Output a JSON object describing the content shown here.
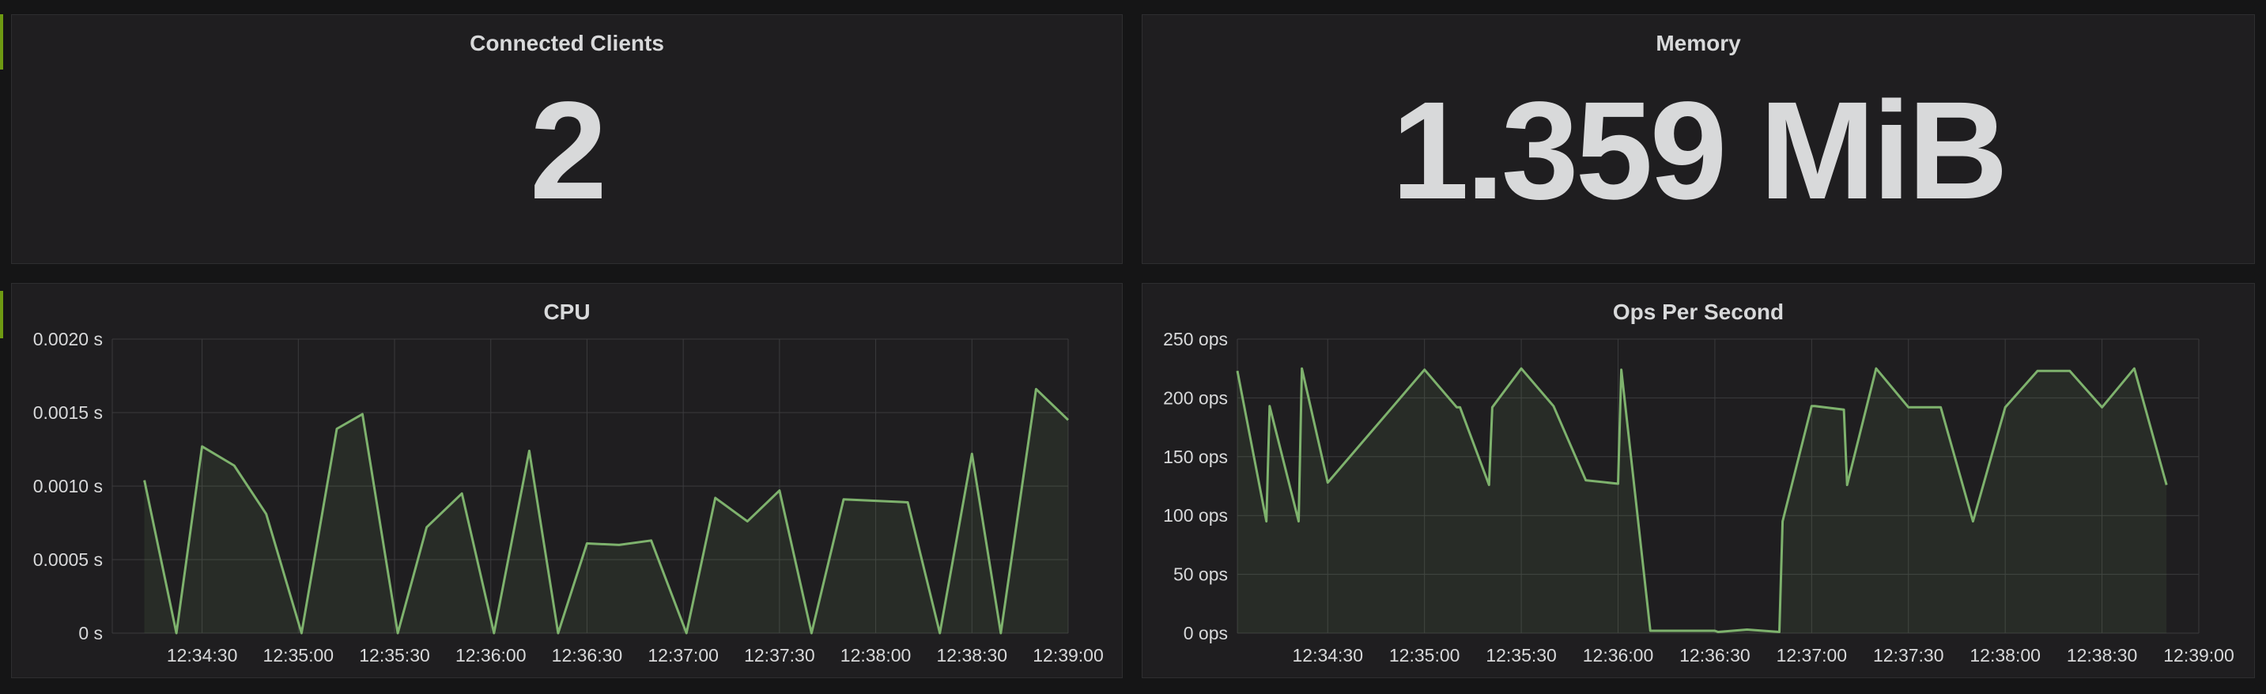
{
  "theme": {
    "background": "#151516",
    "panel": "#1f1e20",
    "row_marker": "#6e9a12",
    "series_color": "#7eb26d",
    "grid": "#3b3b3d"
  },
  "panels": {
    "clients": {
      "title": "Connected Clients",
      "value": "2"
    },
    "memory": {
      "title": "Memory",
      "value": "1.359 MiB"
    },
    "cpu": {
      "title": "CPU"
    },
    "ops": {
      "title": "Ops Per Second"
    }
  },
  "chart_data": [
    {
      "id": "cpu",
      "type": "area",
      "title": "CPU",
      "x_ticks": [
        "12:34:30",
        "12:35:00",
        "12:35:30",
        "12:36:00",
        "12:36:30",
        "12:37:00",
        "12:37:30",
        "12:38:00",
        "12:38:30",
        "12:39:00"
      ],
      "y_ticks": [
        "0 s",
        "0.0005 s",
        "0.0010 s",
        "0.0015 s",
        "0.0020 s"
      ],
      "ylim": [
        0,
        0.002
      ],
      "xlim": [
        "12:34:02",
        "12:39:00"
      ],
      "grid": true,
      "series": [
        {
          "x": [
            "12:34:12",
            "12:34:22",
            "12:34:30",
            "12:34:40",
            "12:34:50",
            "12:35:01",
            "12:35:12",
            "12:35:20",
            "12:35:31",
            "12:35:40",
            "12:35:51",
            "12:36:01",
            "12:36:12",
            "12:36:21",
            "12:36:30",
            "12:36:40",
            "12:36:50",
            "12:37:01",
            "12:37:10",
            "12:37:20",
            "12:37:30",
            "12:37:40",
            "12:37:50",
            "12:38:10",
            "12:38:20",
            "12:38:30",
            "12:38:39",
            "12:38:50",
            "12:39:00"
          ],
          "values": [
            0.00104,
            0,
            0.00127,
            0.00114,
            0.00081,
            0,
            0.00139,
            0.00149,
            0,
            0.00072,
            0.00095,
            0,
            0.00124,
            0,
            0.00061,
            0.0006,
            0.00063,
            0,
            0.00092,
            0.00076,
            0.00097,
            0,
            0.00091,
            0.00089,
            0,
            0.00122,
            0,
            0.00166,
            0.00145
          ]
        }
      ]
    },
    {
      "id": "ops",
      "type": "area",
      "title": "Ops Per Second",
      "x_ticks": [
        "12:34:30",
        "12:35:00",
        "12:35:30",
        "12:36:00",
        "12:36:30",
        "12:37:00",
        "12:37:30",
        "12:38:00",
        "12:38:30",
        "12:39:00"
      ],
      "y_ticks": [
        "0 ops",
        "50 ops",
        "100 ops",
        "150 ops",
        "200 ops",
        "250 ops"
      ],
      "ylim": [
        0,
        250
      ],
      "xlim": [
        "12:34:02",
        "12:39:00"
      ],
      "grid": true,
      "series": [
        {
          "x": [
            "12:34:02",
            "12:34:11",
            "12:34:12",
            "12:34:21",
            "12:34:22",
            "12:34:30",
            "12:34:40",
            "12:34:50",
            "12:35:00",
            "12:35:10",
            "12:35:11",
            "12:35:20",
            "12:35:21",
            "12:35:30",
            "12:35:40",
            "12:35:50",
            "12:36:00",
            "12:36:01",
            "12:36:10",
            "12:36:11",
            "12:36:20",
            "12:36:30",
            "12:36:31",
            "12:36:40",
            "12:36:50",
            "12:36:51",
            "12:37:00",
            "12:37:01",
            "12:37:10",
            "12:37:11",
            "12:37:20",
            "12:37:30",
            "12:37:31",
            "12:37:40",
            "12:37:50",
            "12:38:00",
            "12:38:10",
            "12:38:20",
            "12:38:30",
            "12:38:40",
            "12:38:50"
          ],
          "values": [
            223,
            95,
            193,
            95,
            225,
            128,
            160,
            192,
            224,
            192,
            192,
            126,
            192,
            225,
            193,
            130,
            127,
            224,
            2,
            2,
            2,
            2,
            1,
            3,
            1,
            95,
            193,
            193,
            190,
            126,
            225,
            192,
            192,
            192,
            95,
            192,
            223,
            223,
            192,
            225,
            126
          ]
        }
      ]
    }
  ]
}
